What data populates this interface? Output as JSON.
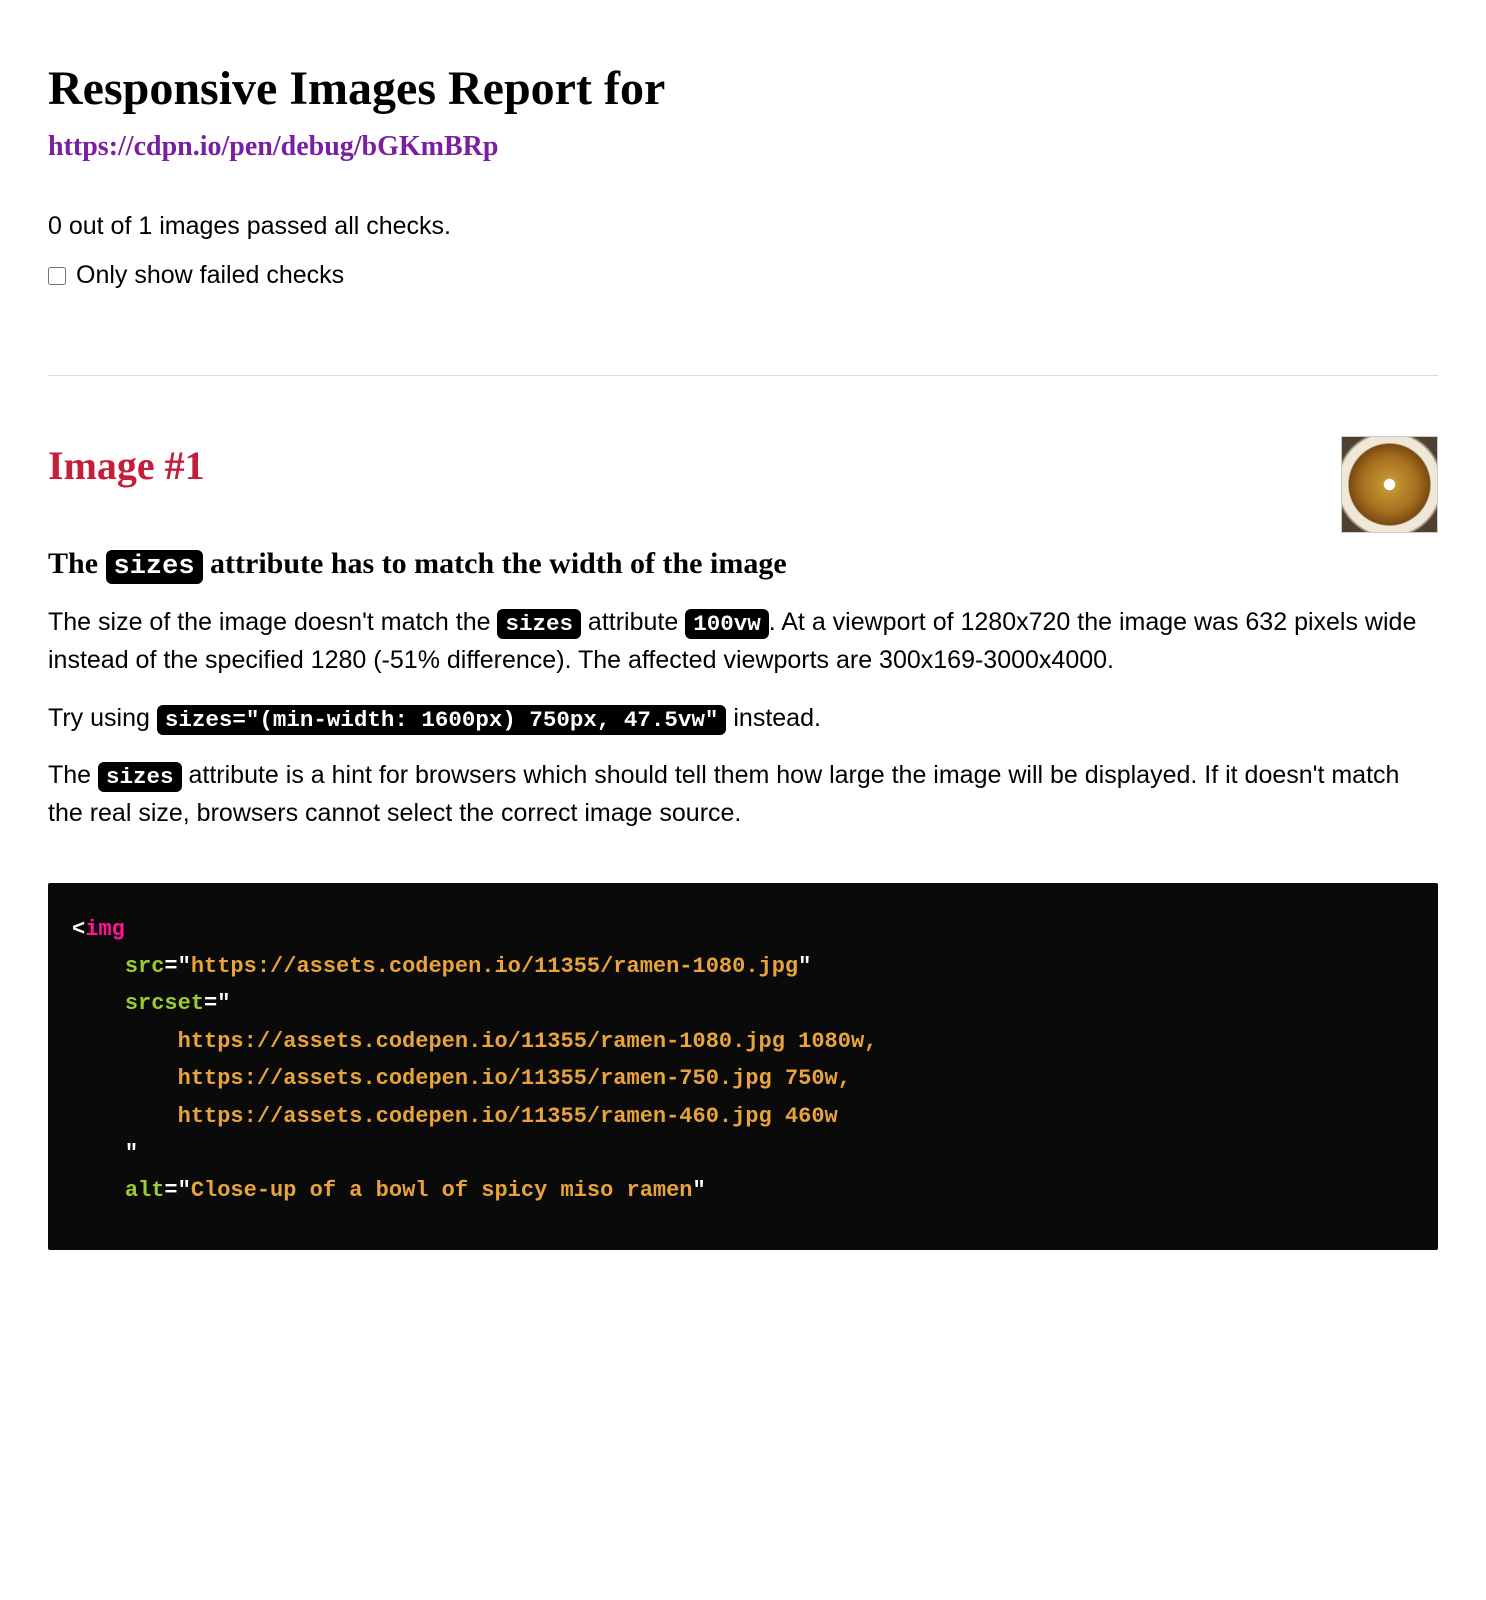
{
  "title": "Responsive Images Report for",
  "report_url": "https://cdpn.io/pen/debug/bGKmBRp",
  "summary": "0 out of 1 images passed all checks.",
  "filter_label": "Only show failed checks",
  "filter_checked": false,
  "image": {
    "heading": "Image #1",
    "check_title_parts": {
      "pre": "The ",
      "code": "sizes",
      "post": " attribute has to match the width of the image"
    },
    "para1": {
      "t1": "The size of the image doesn't match the ",
      "c1": "sizes",
      "t2": " attribute ",
      "c2": "100vw",
      "t3": ". At a viewport of 1280x720 the image was 632 pixels wide instead of the specified 1280 (-51% difference). The affected viewports are 300x169-3000x4000."
    },
    "para2": {
      "t1": "Try using ",
      "c1": "sizes=\"(min-width: 1600px) 750px, 47.5vw\"",
      "t2": " instead."
    },
    "para3": {
      "t1": "The ",
      "c1": "sizes",
      "t2": " attribute is a hint for browsers which should tell them how large the image will be displayed. If it doesn't match the real size, browsers cannot select the correct image source."
    },
    "code": {
      "tag": "img",
      "src_attr": "src",
      "src_val": "https://assets.codepen.io/11355/ramen-1080.jpg",
      "srcset_attr": "srcset",
      "srcset_lines": [
        {
          "url": "https://assets.codepen.io/11355/ramen-1080.jpg",
          "w": "1080w",
          "comma": ","
        },
        {
          "url": "https://assets.codepen.io/11355/ramen-750.jpg",
          "w": "750w",
          "comma": ","
        },
        {
          "url": "https://assets.codepen.io/11355/ramen-460.jpg",
          "w": "460w",
          "comma": ""
        }
      ],
      "alt_attr": "alt",
      "alt_val": "Close-up of a bowl of spicy miso ramen"
    }
  }
}
